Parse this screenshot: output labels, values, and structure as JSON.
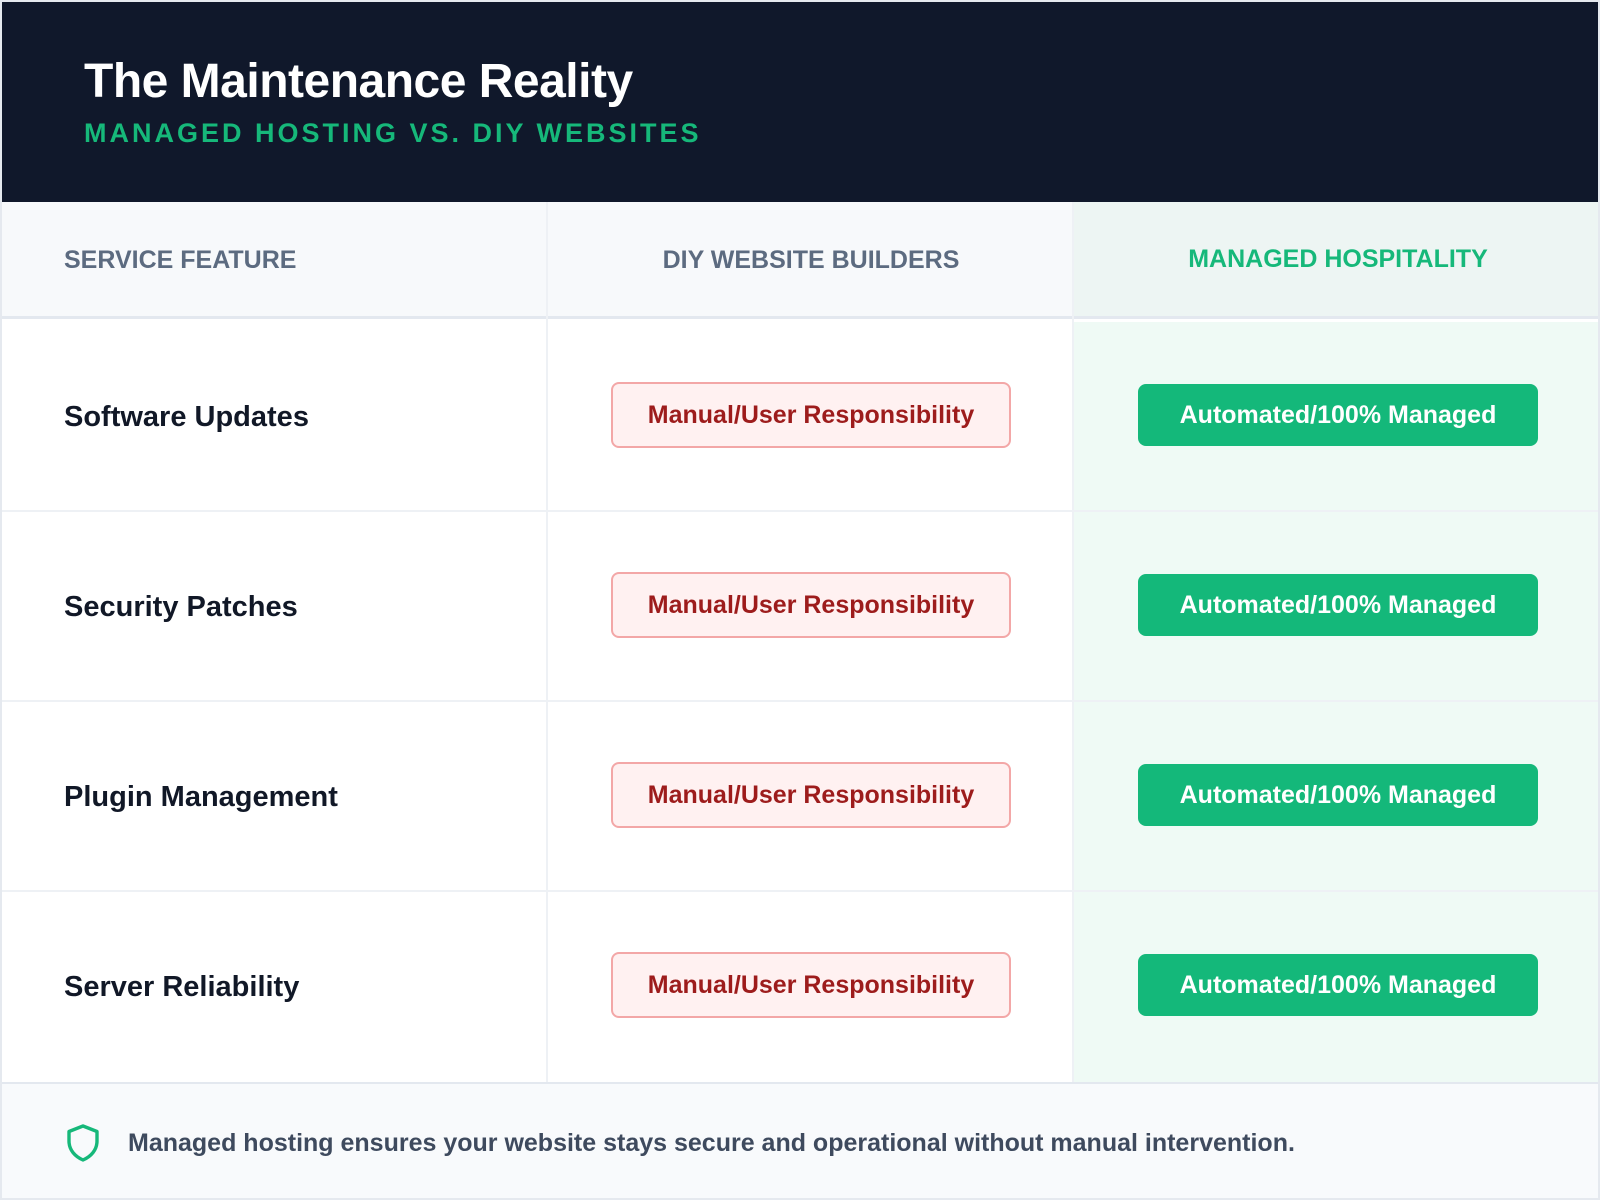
{
  "header": {
    "title": "The Maintenance Reality",
    "subtitle": "MANAGED HOSTING VS. DIY WEBSITES"
  },
  "table": {
    "columns": [
      "SERVICE FEATURE",
      "DIY WEBSITE BUILDERS",
      "MANAGED HOSPITALITY"
    ],
    "rows": [
      {
        "feature": "Software Updates",
        "diy": "Manual/User Responsibility",
        "managed": "Automated/100% Managed"
      },
      {
        "feature": "Security Patches",
        "diy": "Manual/User Responsibility",
        "managed": "Automated/100% Managed"
      },
      {
        "feature": "Plugin Management",
        "diy": "Manual/User Responsibility",
        "managed": "Automated/100% Managed"
      },
      {
        "feature": "Server Reliability",
        "diy": "Manual/User Responsibility",
        "managed": "Automated/100% Managed"
      }
    ]
  },
  "footer": {
    "icon": "shield-icon",
    "text": "Managed hosting ensures your website stays secure and operational without manual intervention."
  },
  "colors": {
    "header_bg": "#10182b",
    "accent_green": "#14b87a",
    "diy_red": "#9d1c1c",
    "diy_badge_bg": "#fff1f1"
  }
}
